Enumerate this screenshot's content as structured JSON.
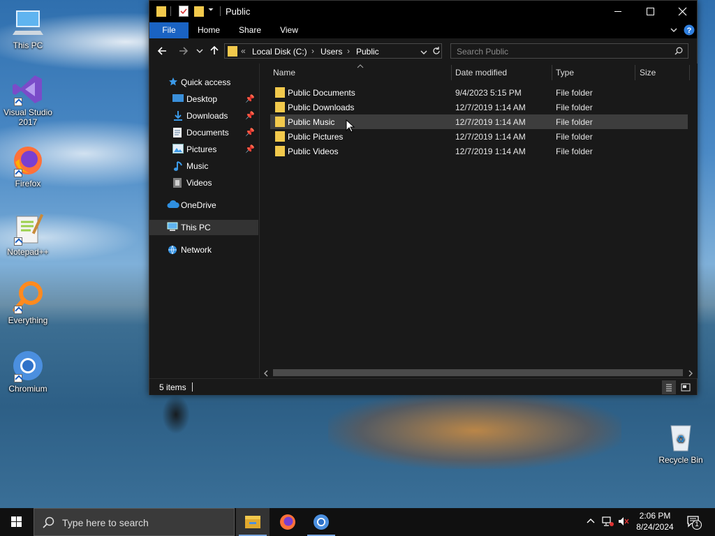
{
  "desktop": {
    "icons": [
      {
        "label": "This PC"
      },
      {
        "label": "Visual Studio 2017"
      },
      {
        "label": "Firefox"
      },
      {
        "label": "Notepad++"
      },
      {
        "label": "Everything"
      },
      {
        "label": "Chromium"
      },
      {
        "label": "Recycle Bin"
      }
    ]
  },
  "window": {
    "title": "Public",
    "ribbon_tabs": [
      "File",
      "Home",
      "Share",
      "View"
    ],
    "address": {
      "prefix": "«",
      "crumbs": [
        "Local Disk (C:)",
        "Users",
        "Public"
      ]
    },
    "search_placeholder": "Search Public",
    "nav": {
      "quick_access": "Quick access",
      "quick_items": [
        "Desktop",
        "Downloads",
        "Documents",
        "Pictures",
        "Music",
        "Videos"
      ],
      "onedrive": "OneDrive",
      "this_pc": "This PC",
      "network": "Network"
    },
    "columns": [
      "Name",
      "Date modified",
      "Type",
      "Size"
    ],
    "rows": [
      {
        "name": "Public Documents",
        "date": "9/4/2023 5:15 PM",
        "type": "File folder"
      },
      {
        "name": "Public Downloads",
        "date": "12/7/2019 1:14 AM",
        "type": "File folder"
      },
      {
        "name": "Public Music",
        "date": "12/7/2019 1:14 AM",
        "type": "File folder"
      },
      {
        "name": "Public Pictures",
        "date": "12/7/2019 1:14 AM",
        "type": "File folder"
      },
      {
        "name": "Public Videos",
        "date": "12/7/2019 1:14 AM",
        "type": "File folder"
      }
    ],
    "status": "5 items"
  },
  "taskbar": {
    "search_placeholder": "Type here to search",
    "time": "2:06 PM",
    "date": "8/24/2024",
    "notification_count": "1"
  },
  "colors": {
    "accent": "#1a63c3",
    "folder": "#f2c94c",
    "window_bg": "#191919"
  }
}
